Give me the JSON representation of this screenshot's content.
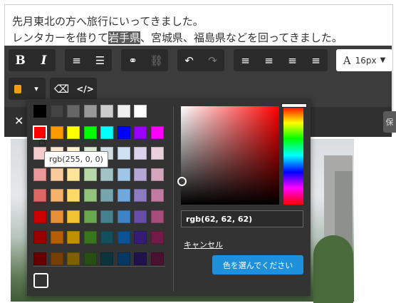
{
  "editor": {
    "line1": "先月東北の方へ旅行にいってきました。",
    "line2_before": "レンタカーを借りて",
    "line2_selected": "岩手県",
    "line2_after": "、宮城県、福島県などを回ってきました。"
  },
  "toolbar": {
    "bold": "B",
    "italic": "I",
    "ordered_list": "≡",
    "unordered_list": "☰",
    "link": "⚭",
    "unlink": "⛓",
    "undo": "↶",
    "redo": "↷",
    "align_left": "≡",
    "align_center": "≡",
    "align_right": "≡",
    "align_justify": "≡",
    "font_size": "16px",
    "color_dropdown": "▾",
    "eraser": "⌫",
    "code": "</>",
    "close": "✕",
    "right_chip": "保"
  },
  "color_picker": {
    "swatch_rows": [
      [
        "#000000",
        "#434343",
        "#666666",
        "#999999",
        "#cccccc",
        "#efefef",
        "#ffffff",
        ""
      ],
      [
        "#ff0000",
        "#ff9900",
        "#ffff00",
        "#00ff00",
        "#00ffff",
        "#0000ff",
        "#9900ff",
        "#ff00ff"
      ],
      [
        "#f4cccc",
        "#fce5cd",
        "#fff2cc",
        "#d9ead3",
        "#d0e0e3",
        "#cfe2f3",
        "#d9d2e9",
        "#ead1dc"
      ],
      [
        "#ea9999",
        "#f9cb9c",
        "#ffe599",
        "#b6d7a8",
        "#a2c4c9",
        "#9fc5e8",
        "#b4a7d6",
        "#d5a6bd"
      ],
      [
        "#e06666",
        "#f6b26b",
        "#ffd966",
        "#93c47d",
        "#76a5af",
        "#6fa8dc",
        "#8e7cc3",
        "#c27ba0"
      ],
      [
        "#cc0000",
        "#e69138",
        "#f1c232",
        "#6aa84f",
        "#45818e",
        "#3d85c6",
        "#674ea7",
        "#a64d79"
      ],
      [
        "#990000",
        "#b45f06",
        "#bf9000",
        "#38761d",
        "#134f5c",
        "#0b5394",
        "#351c75",
        "#741b47"
      ],
      [
        "#660000",
        "#783f04",
        "#7f6000",
        "#274e13",
        "#0c343d",
        "#073763",
        "#20124d",
        "#4c1130"
      ]
    ],
    "rgb_value": "rgb(62, 62, 62)",
    "cancel": "キャンセル",
    "choose": "色を選んでください",
    "tooltip": "rgb(255, 0, 0)",
    "current_color": "#f39c12"
  }
}
